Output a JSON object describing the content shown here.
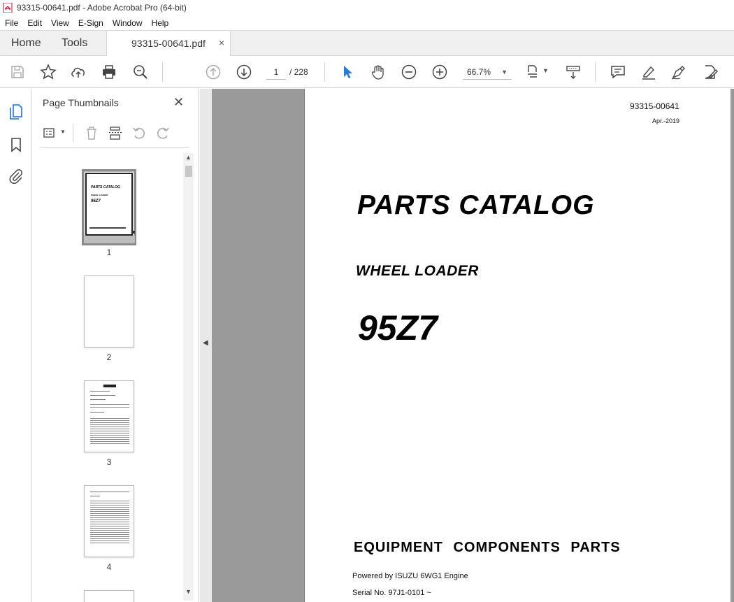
{
  "window": {
    "title": "93315-00641.pdf - Adobe Acrobat Pro (64-bit)"
  },
  "menu": [
    "File",
    "Edit",
    "View",
    "E-Sign",
    "Window",
    "Help"
  ],
  "tabs": {
    "home": "Home",
    "tools": "Tools",
    "document": "93315-00641.pdf",
    "close": "×"
  },
  "toolbar": {
    "current_page": "1",
    "total_pages": "/ 228",
    "zoom": "66.7%"
  },
  "panel": {
    "title": "Page Thumbnails",
    "close": "✕",
    "thumbnails": [
      {
        "label": "1",
        "title_text": "PARTS CATALOG",
        "sub_text": "WHEEL LOADER",
        "model_text": "95Z7"
      },
      {
        "label": "2"
      },
      {
        "label": "3"
      },
      {
        "label": "4"
      }
    ]
  },
  "document": {
    "doc_id": "93315-00641",
    "date": "Apr.-2019",
    "title": "PARTS CATALOG",
    "subtitle": "WHEEL LOADER",
    "model": "95Z7",
    "section": "EQUIPMENT  COMPONENTS  PARTS",
    "powered_by": "Powered by ISUZU 6WG1 Engine",
    "serial": "Serial No. 97J1-0101 ~"
  },
  "colors": {
    "accent": "#1473e6",
    "select_arrow": "#2b78d6",
    "doc_bg": "#9a9a9a"
  }
}
